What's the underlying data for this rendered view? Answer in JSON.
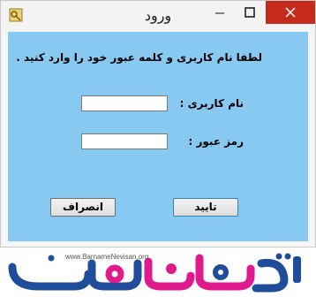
{
  "window": {
    "title": "ورود",
    "prompt": "لطفا نام کاربری و کلمه عبور خود را وارد کنید .",
    "username_label": "نام کاربری :",
    "password_label": "رمز عبور :",
    "username_value": "",
    "password_value": "",
    "ok_label": "تایید",
    "cancel_label": "انصراف"
  },
  "watermark": {
    "url": "www.BarnameNevisan.org",
    "logo_text": "برنامه نویسان"
  },
  "colors": {
    "client_background": "#87c9f1",
    "close_button": "#c42b1c",
    "logo_blue": "#1f4c9b",
    "logo_magenta": "#e0198c"
  }
}
